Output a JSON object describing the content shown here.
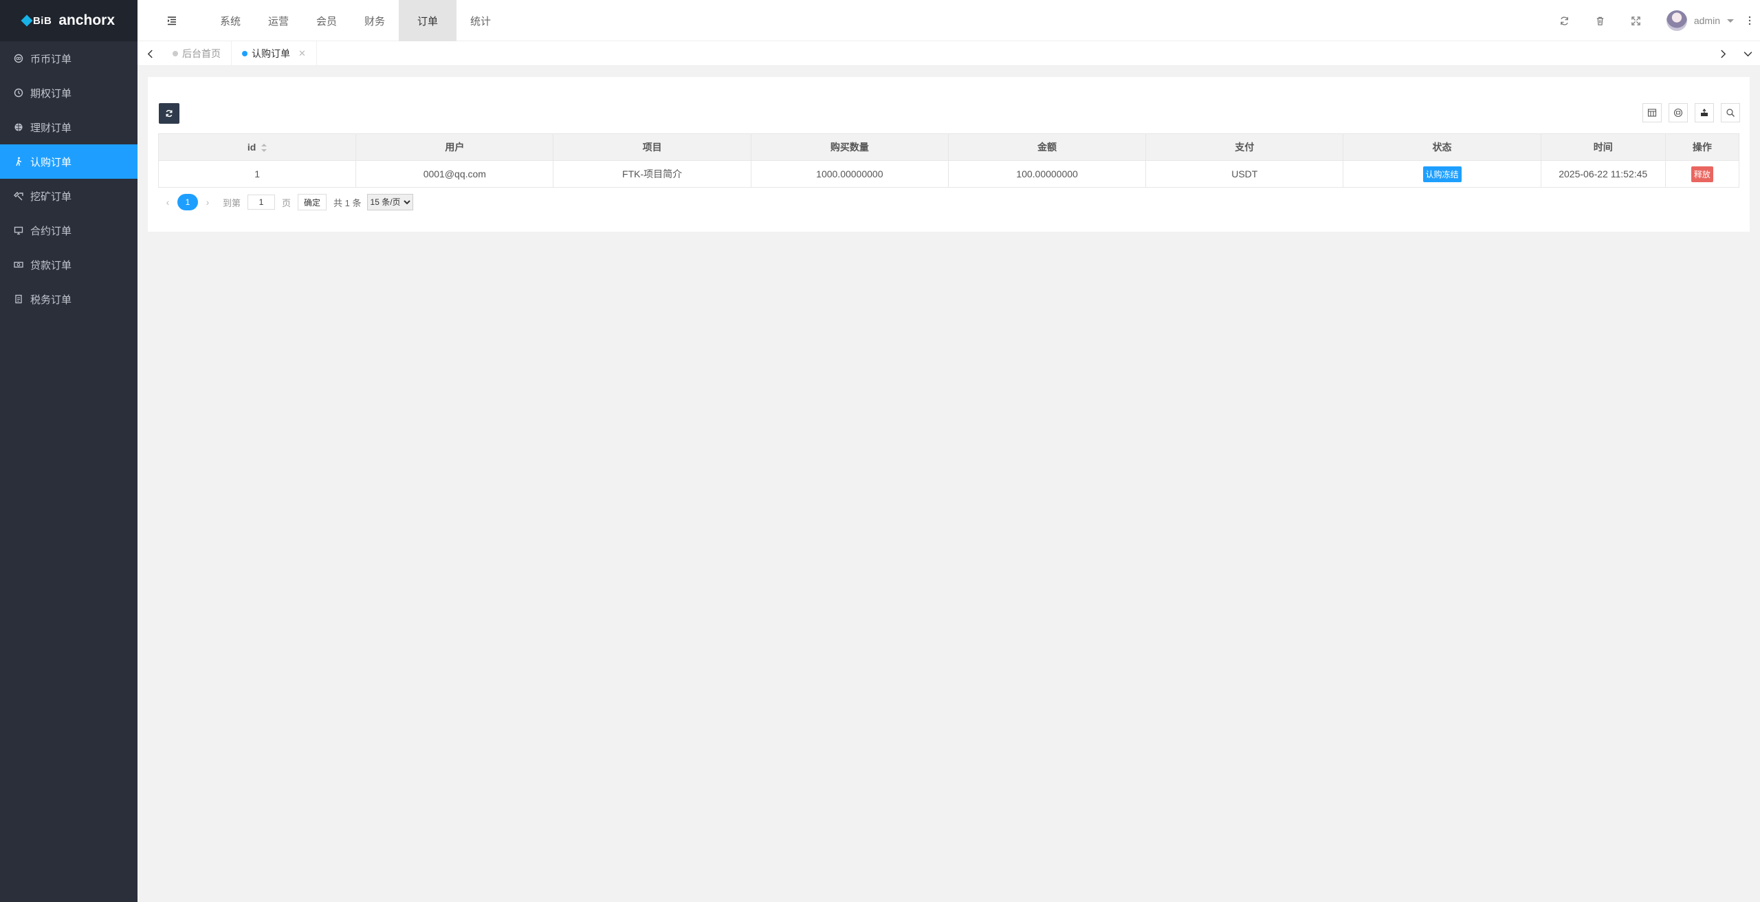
{
  "brand": {
    "mark": "BiB",
    "name": "anchorx"
  },
  "sidebar": {
    "items": [
      {
        "label": "币币订单",
        "icon": "coin-icon"
      },
      {
        "label": "期权订单",
        "icon": "clock-icon"
      },
      {
        "label": "理财订单",
        "icon": "globe-icon"
      },
      {
        "label": "认购订单",
        "icon": "walker-icon",
        "active": true
      },
      {
        "label": "挖矿订单",
        "icon": "pickaxe-icon"
      },
      {
        "label": "合约订单",
        "icon": "monitor-icon"
      },
      {
        "label": "贷款订单",
        "icon": "cash-icon"
      },
      {
        "label": "税务订单",
        "icon": "document-icon"
      }
    ]
  },
  "header": {
    "nav": [
      "系统",
      "运营",
      "会员",
      "财务",
      "订单",
      "统计"
    ],
    "active_nav": "订单",
    "user": "admin"
  },
  "tabs": [
    {
      "label": "后台首页",
      "active": false
    },
    {
      "label": "认购订单",
      "active": true,
      "closable": true
    }
  ],
  "table": {
    "columns": [
      "id",
      "用户",
      "项目",
      "购买数量",
      "金额",
      "支付",
      "状态",
      "时间",
      "操作"
    ],
    "rows": [
      {
        "id": "1",
        "user": "0001@qq.com",
        "project": "FTK-项目简介",
        "quantity": "1000.00000000",
        "amount": "100.00000000",
        "pay": "USDT",
        "status": "认购冻结",
        "time": "2025-06-22 11:52:45",
        "action": "释放"
      }
    ]
  },
  "pager": {
    "current": "1",
    "goto_label": "到第",
    "goto_value": "1",
    "page_unit": "页",
    "confirm": "确定",
    "total": "共 1 条",
    "page_size": "15 条/页"
  },
  "colors": {
    "accent": "#1e9fff",
    "sidebar_bg": "#2a2f3a",
    "danger": "#e9655f"
  }
}
